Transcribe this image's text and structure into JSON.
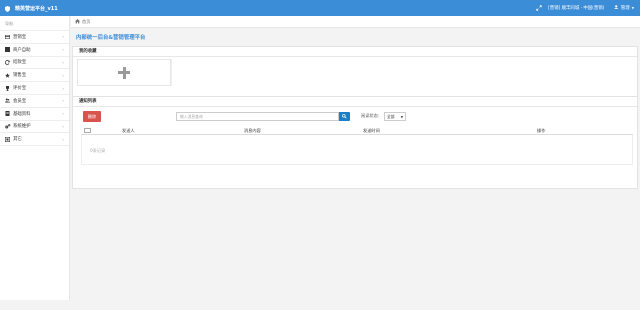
{
  "app": {
    "title": "精英营运平台_v11",
    "org_text": "[营销] 顺丰同城 · 中国(营销)",
    "user_name": "管理"
  },
  "sidebar": {
    "heading": "导航",
    "items": [
      {
        "label": "营销宝",
        "icon": "wallet-icon"
      },
      {
        "label": "商户自助",
        "icon": "store-icon"
      },
      {
        "label": "结款宝",
        "icon": "refresh-icon"
      },
      {
        "label": "销售宝",
        "icon": "star-icon"
      },
      {
        "label": "评价宝",
        "icon": "trophy-icon"
      },
      {
        "label": "会员宝",
        "icon": "users-icon"
      },
      {
        "label": "基础资料",
        "icon": "file-icon"
      },
      {
        "label": "系统维护",
        "icon": "cogs-icon"
      },
      {
        "label": "其它",
        "icon": "square-icon"
      }
    ]
  },
  "breadcrumb": {
    "home": "首页"
  },
  "main": {
    "title": "内部统一后台&营销管理平台"
  },
  "favorites": {
    "heading": "我的收藏"
  },
  "notices": {
    "heading": "通知列表",
    "delete_label": "删除",
    "search_placeholder": "输入消息查询",
    "filter_label": "阅读状态:",
    "filter_value": "全部",
    "columns": [
      "发送人",
      "消息内容",
      "发送时间",
      "操作"
    ],
    "empty_text": "0条记录"
  },
  "colors": {
    "primary": "#3c8dd8",
    "danger": "#d9534f",
    "search_button": "#1c7fc9"
  }
}
